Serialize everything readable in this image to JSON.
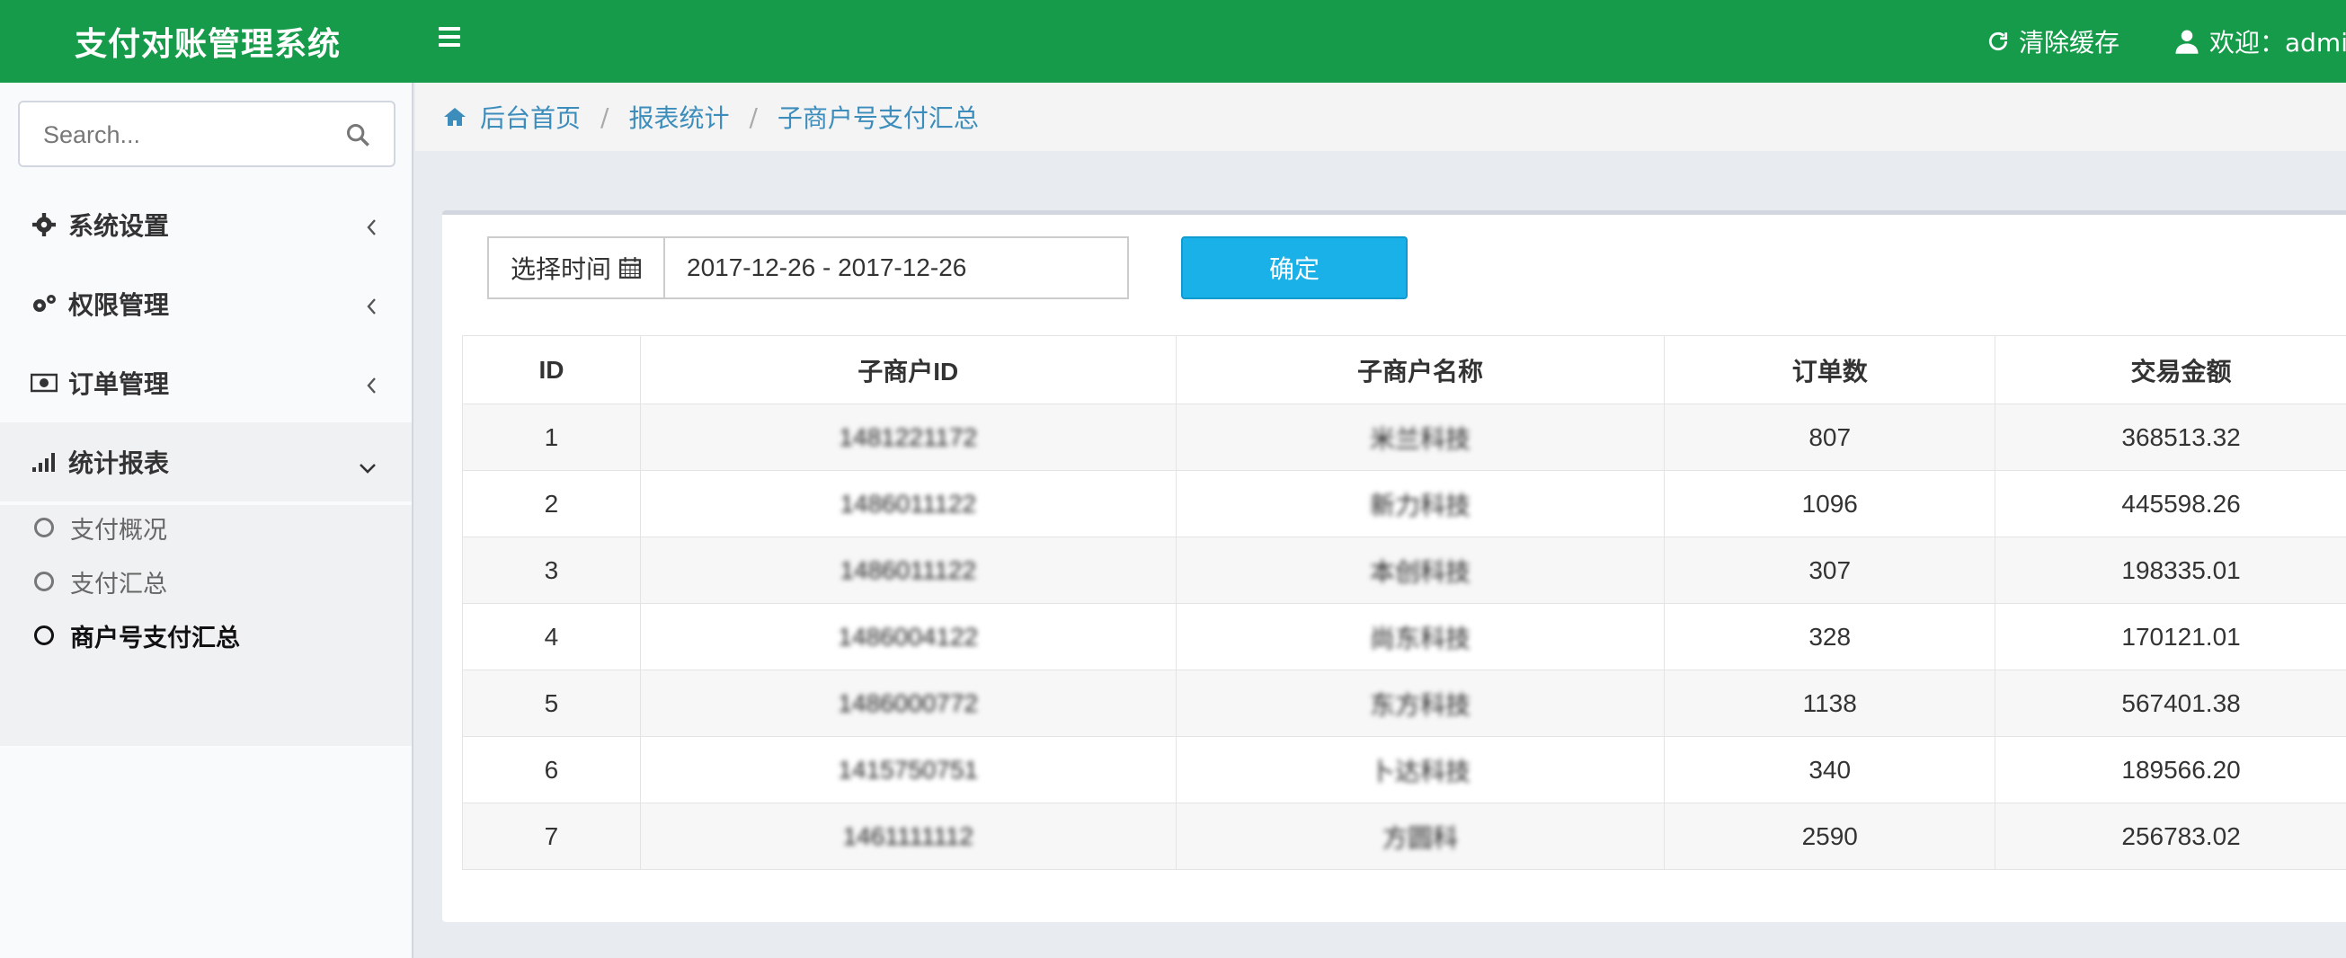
{
  "header": {
    "app_title": "支付对账管理系统",
    "clear_cache_label": "清除缓存",
    "welcome_text": "欢迎：admi"
  },
  "sidebar": {
    "search_placeholder": "Search...",
    "menu": [
      {
        "label": "系统设置",
        "icon": "gear-icon",
        "expanded": false
      },
      {
        "label": "权限管理",
        "icon": "gears-icon",
        "expanded": false
      },
      {
        "label": "订单管理",
        "icon": "money-icon",
        "expanded": false
      },
      {
        "label": "统计报表",
        "icon": "signal-icon",
        "expanded": true
      }
    ],
    "submenu": [
      {
        "label": "支付概况",
        "active": false
      },
      {
        "label": "支付汇总",
        "active": false
      },
      {
        "label": "商户号支付汇总",
        "active": true
      }
    ]
  },
  "breadcrumb": [
    "后台首页",
    "报表统计",
    "子商户号支付汇总"
  ],
  "filter": {
    "date_label": "选择时间",
    "date_value": "2017-12-26 - 2017-12-26",
    "confirm_label": "确定"
  },
  "table": {
    "headers": [
      "ID",
      "子商户ID",
      "子商户名称",
      "订单数",
      "交易金额"
    ],
    "rows": [
      {
        "id": "1",
        "sub_id": "1481221172",
        "name": "米兰科技",
        "orders": "807",
        "amount": "368513.32"
      },
      {
        "id": "2",
        "sub_id": "1486011122",
        "name": "新力科技",
        "orders": "1096",
        "amount": "445598.26"
      },
      {
        "id": "3",
        "sub_id": "1486011122",
        "name": "本创科技",
        "orders": "307",
        "amount": "198335.01"
      },
      {
        "id": "4",
        "sub_id": "1486004122",
        "name": "尚东科技",
        "orders": "328",
        "amount": "170121.01"
      },
      {
        "id": "5",
        "sub_id": "1486000772",
        "name": "东方科技",
        "orders": "1138",
        "amount": "567401.38"
      },
      {
        "id": "6",
        "sub_id": "1415750751",
        "name": "卜达科技",
        "orders": "340",
        "amount": "189566.20"
      },
      {
        "id": "7",
        "sub_id": "1461111112",
        "name": "方圆科",
        "orders": "2590",
        "amount": "256783.02"
      }
    ]
  },
  "colors": {
    "header_bg": "#169b4a",
    "accent_link": "#3c8dbc",
    "confirm_btn": "#1ab0e8"
  }
}
